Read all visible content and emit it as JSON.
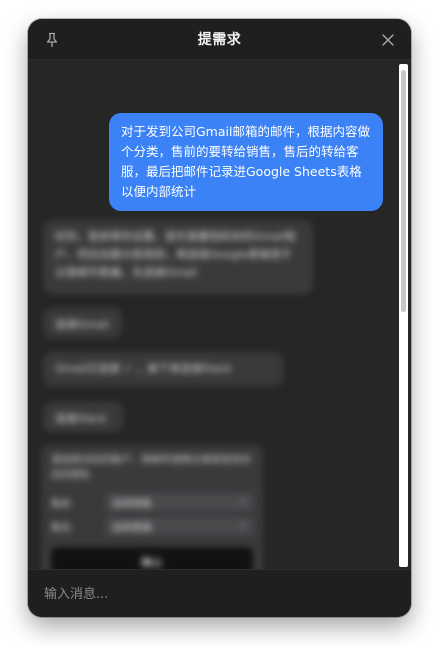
{
  "window": {
    "title": "提需求"
  },
  "messages": {
    "user": "对于发到公司Gmail邮箱的邮件，根据内容做个分类，售前的要转给销售，售后的转给客服，最后把邮件记录进Google Sheets表格以便内部统计",
    "bot_1": "好的，我来帮你设置。首先需要授权你的Gmail账户，然后创建分类规则，再连接Google表格用于记录邮件数据。先连接Gmail",
    "bot_2": "连接Gmail",
    "bot_3": "Gmail已连接 ✓ ，接下来连接Slack",
    "bot_4": "连接Slack",
    "form": {
      "description": "请选择对应的账户，将邮件按照分类转发到对应的团队",
      "row1_label": "售前",
      "row1_value": "选择销售",
      "row2_label": "售后",
      "row2_value": "选择客服",
      "button": "确认"
    }
  },
  "input": {
    "placeholder": "输入消息..."
  },
  "icons": {
    "pin": "pin-icon",
    "close": "close-icon"
  },
  "colors": {
    "accent": "#3b82f6",
    "window_bg": "#1f1f20",
    "chat_bg": "#262627"
  }
}
